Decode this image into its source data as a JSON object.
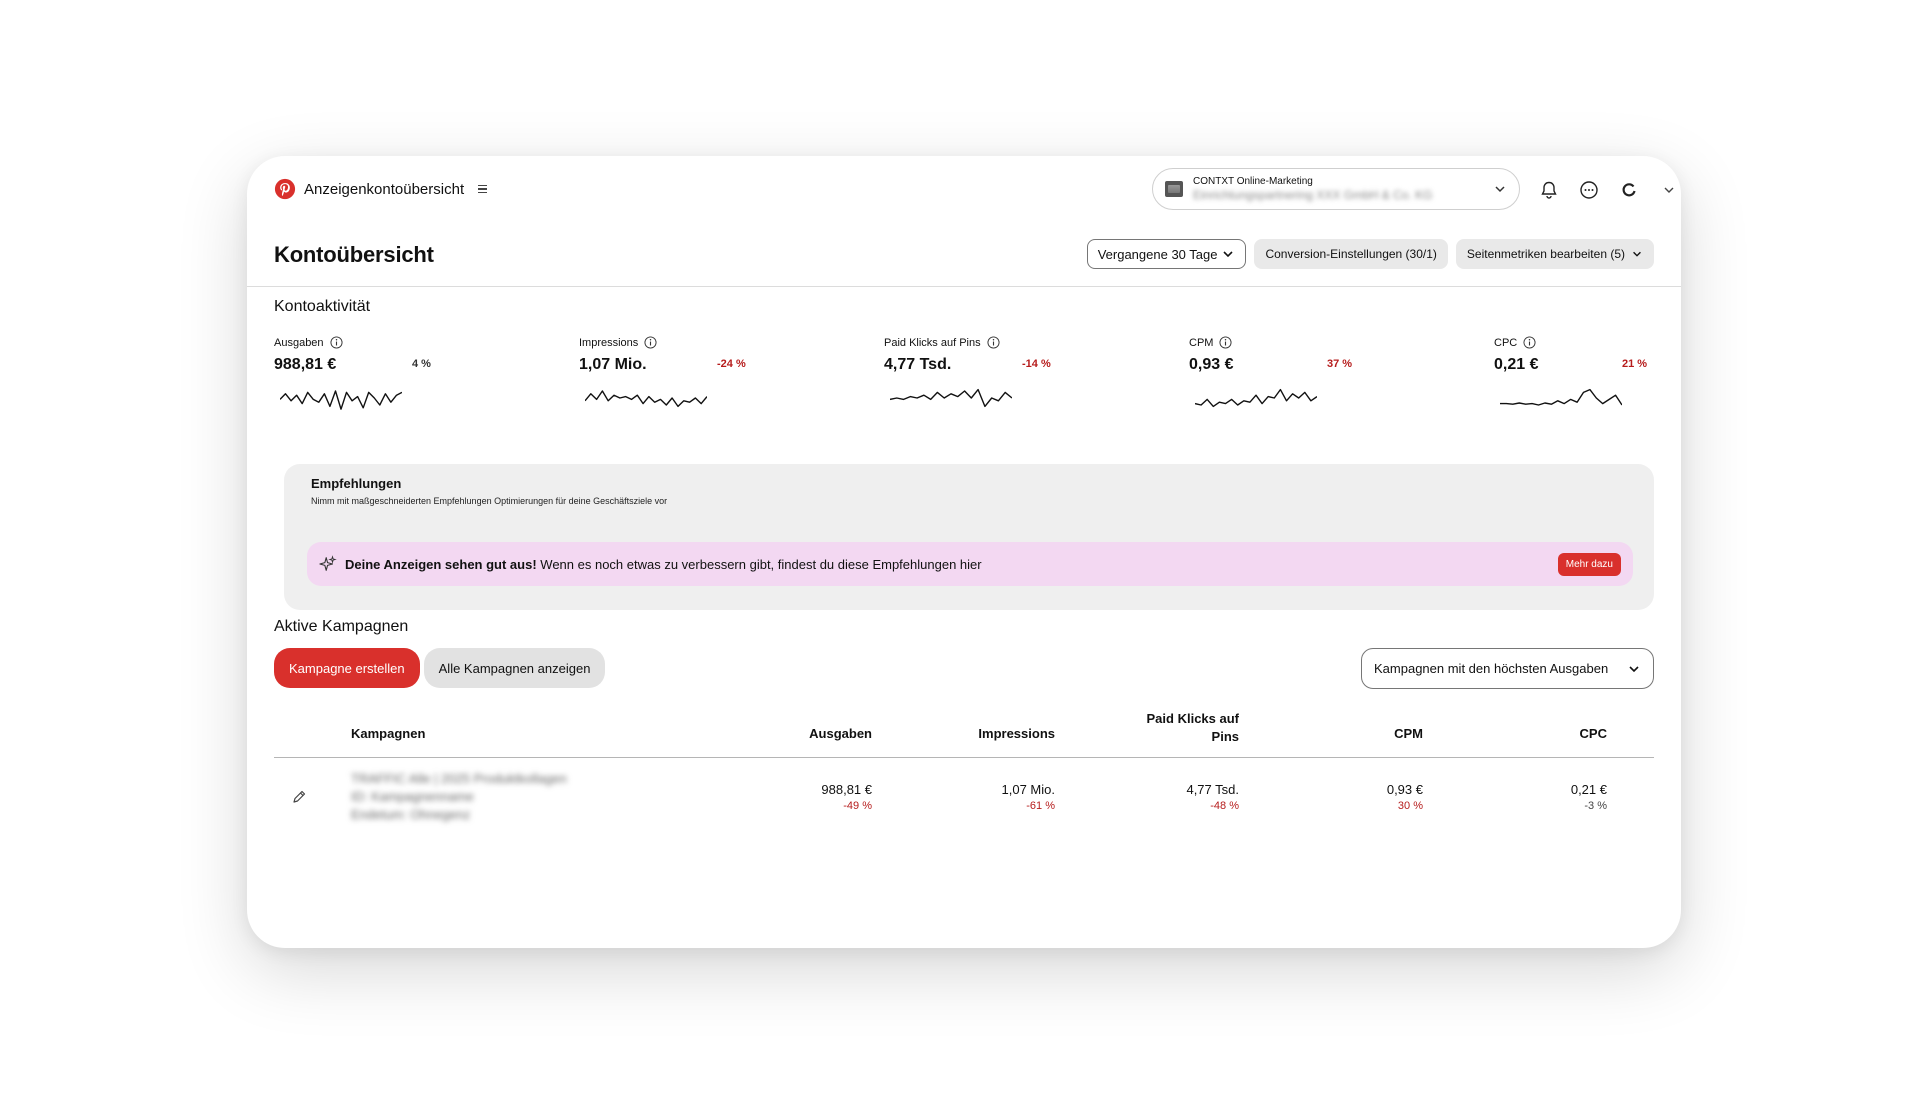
{
  "app": {
    "title": "Anzeigenkontoübersicht",
    "account": {
      "name": "CONTXT Online-Marketing",
      "sub_blurred": "Einrichtungspartnering XXX GmbH & Co. KG"
    }
  },
  "header": {
    "title": "Kontoübersicht",
    "date_range": "Vergangene 30 Tage",
    "conversion_settings": "Conversion-Einstellungen (30/1)",
    "edit_metrics": "Seitenmetriken bearbeiten (5)"
  },
  "activity": {
    "title": "Kontoaktivität",
    "metrics": [
      {
        "label": "Ausgaben",
        "value": "988,81 €",
        "change": "4 %",
        "trend": "neutral",
        "spark": [
          0.55,
          0.35,
          0.6,
          0.4,
          0.7,
          0.3,
          0.55,
          0.65,
          0.35,
          0.8,
          0.25,
          0.9,
          0.3,
          0.6,
          0.45,
          0.85,
          0.3,
          0.5,
          0.75,
          0.35,
          0.65,
          0.4,
          0.3
        ]
      },
      {
        "label": "Impressions",
        "value": "1,07 Mio.",
        "change": "-24 %",
        "trend": "negative",
        "spark": [
          0.6,
          0.35,
          0.55,
          0.25,
          0.6,
          0.4,
          0.5,
          0.45,
          0.55,
          0.4,
          0.7,
          0.45,
          0.65,
          0.55,
          0.75,
          0.5,
          0.8,
          0.6,
          0.65,
          0.5,
          0.7,
          0.45
        ]
      },
      {
        "label": "Paid Klicks auf Pins",
        "value": "4,77 Tsd.",
        "change": "-14 %",
        "trend": "negative",
        "spark": [
          0.55,
          0.5,
          0.55,
          0.45,
          0.5,
          0.4,
          0.55,
          0.3,
          0.5,
          0.35,
          0.45,
          0.25,
          0.5,
          0.2,
          0.8,
          0.5,
          0.6,
          0.3,
          0.5
        ]
      },
      {
        "label": "CPM",
        "value": "0,93 €",
        "change": "37 %",
        "trend": "negative",
        "spark": [
          0.7,
          0.75,
          0.55,
          0.8,
          0.65,
          0.7,
          0.55,
          0.75,
          0.6,
          0.65,
          0.4,
          0.7,
          0.45,
          0.5,
          0.2,
          0.6,
          0.35,
          0.5,
          0.3,
          0.6,
          0.45
        ]
      },
      {
        "label": "CPC",
        "value": "0,21 €",
        "change": "21 %",
        "trend": "negative",
        "spark": [
          0.7,
          0.7,
          0.72,
          0.68,
          0.72,
          0.7,
          0.75,
          0.68,
          0.72,
          0.6,
          0.7,
          0.55,
          0.65,
          0.3,
          0.2,
          0.5,
          0.7,
          0.55,
          0.4,
          0.75
        ]
      }
    ]
  },
  "recommendations": {
    "title": "Empfehlungen",
    "subtitle": "Nimm mit maßgeschneiderten Empfehlungen Optimierungen für deine Geschäftsziele vor",
    "banner_bold": "Deine Anzeigen sehen gut aus!",
    "banner_text": " Wenn es noch etwas zu verbessern gibt, findest du diese Empfehlungen hier",
    "button": "Mehr dazu"
  },
  "campaigns": {
    "title": "Aktive Kampagnen",
    "create_button": "Kampagne erstellen",
    "view_all_button": "Alle Kampagnen anzeigen",
    "sort_select": "Kampagnen mit den höchsten Ausgaben",
    "columns": {
      "name": "Kampagnen",
      "spend": "Ausgaben",
      "impressions": "Impressions",
      "paid_clicks": "Paid Klicks auf Pins",
      "cpm": "CPM",
      "cpc": "CPC"
    },
    "rows": [
      {
        "name_lines": [
          "TRAFFIC Alle | 2025 Produktkollagen",
          "ID: Kampagnenname",
          "Endetum: Ohnegenz"
        ],
        "spend": "988,81 €",
        "spend_change": "-49 %",
        "impressions": "1,07 Mio.",
        "impressions_change": "-61 %",
        "paid_clicks": "4,77 Tsd.",
        "paid_clicks_change": "-48 %",
        "cpm": "0,93 €",
        "cpm_change": "30 %",
        "cpc": "0,21 €",
        "cpc_change": "-3 %"
      }
    ]
  },
  "colors": {
    "brand_red": "#d9302c",
    "negative": "#b61c1c",
    "reco_banner": "#f3d8f2",
    "card_bg": "#efefef"
  },
  "icons": [
    "pinterest-logo-icon",
    "menu-icon",
    "chevron-down-icon",
    "bell-icon",
    "chat-icon",
    "profile-icon",
    "info-icon",
    "sparkle-icon",
    "edit-icon"
  ]
}
